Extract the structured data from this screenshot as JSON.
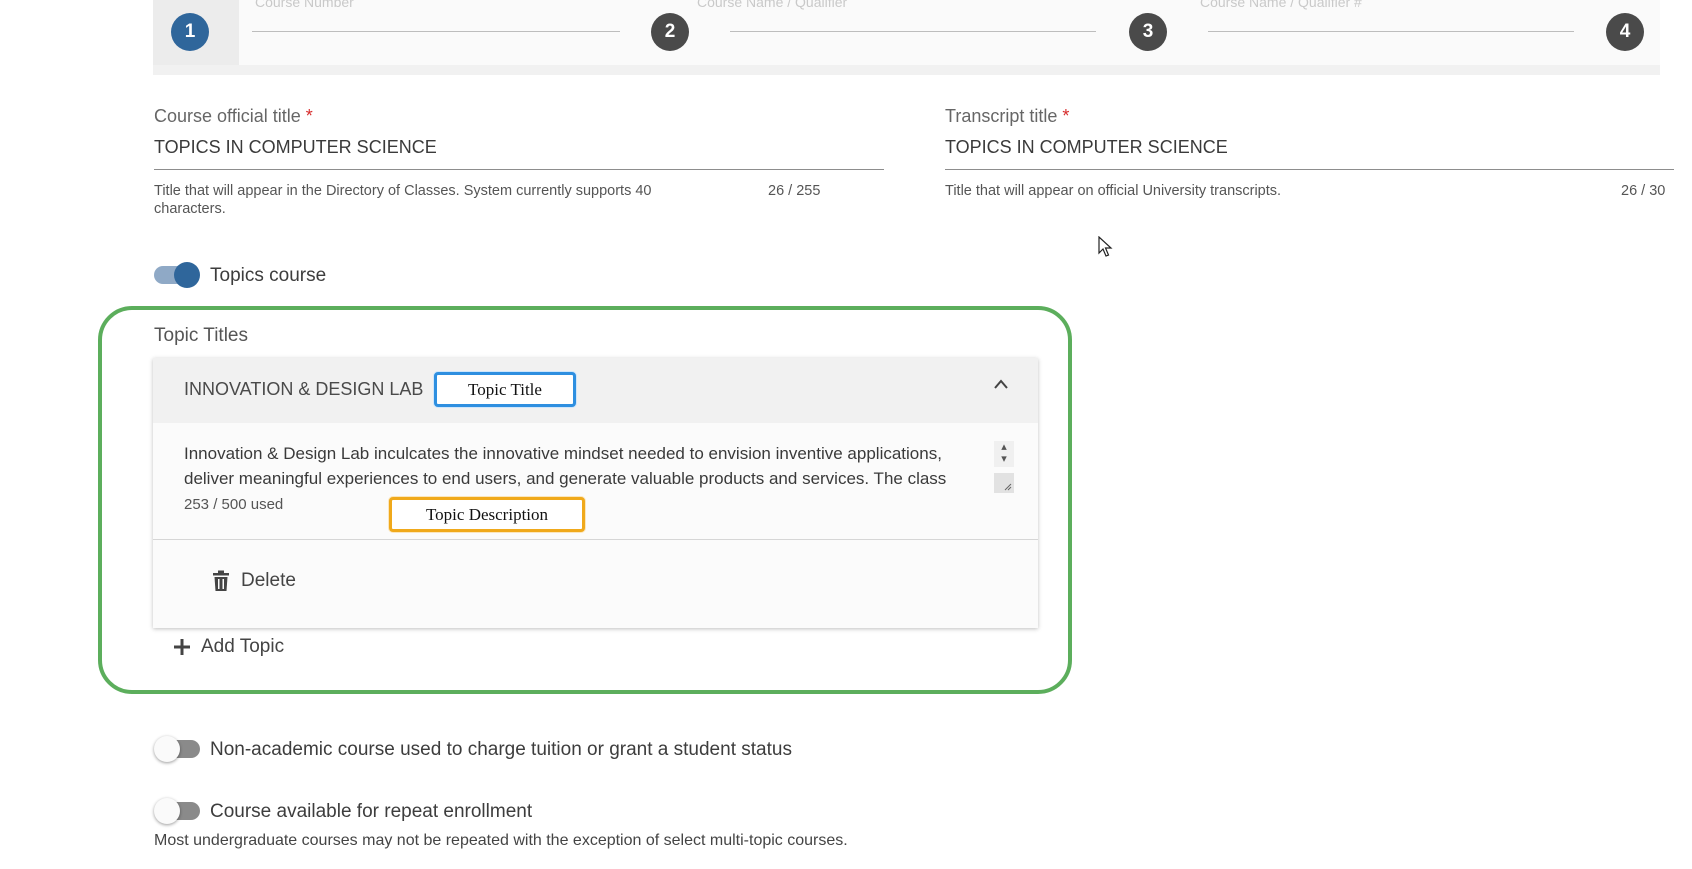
{
  "stepper": {
    "steps": [
      {
        "number": "1",
        "label": "Course Number",
        "active": true
      },
      {
        "number": "2",
        "label": "Course Name / Qualifier",
        "active": false
      },
      {
        "number": "3",
        "label": "Course Name / Qualifier #",
        "active": false
      },
      {
        "number": "4",
        "label": "",
        "active": false
      }
    ]
  },
  "official_title": {
    "label": "Course official title",
    "required_mark": "*",
    "value": "TOPICS IN COMPUTER SCIENCE",
    "helper_line1": "Title that will appear in the Directory of Classes. System currently supports 40",
    "helper_line2": "characters.",
    "counter": "26 / 255"
  },
  "transcript_title": {
    "label": "Transcript title",
    "required_mark": "*",
    "value": "TOPICS IN COMPUTER SCIENCE",
    "helper": "Title that will appear on official University transcripts.",
    "counter": "26 / 30"
  },
  "topics_toggle": {
    "label": "Topics course",
    "on": true,
    "color": "#2f669b"
  },
  "topics": {
    "section_label": "Topic Titles",
    "item": {
      "title": "INNOVATION & DESIGN LAB",
      "description_line1": "Innovation & Design Lab inculcates the innovative mindset needed to envision inventive applications,",
      "description_line2": "deliver meaningful experiences to end users, and generate valuable products and services. The class",
      "used": "253 / 500 used",
      "collapse_icon": "chevron-up-icon"
    },
    "delete_label": "Delete",
    "add_label": "Add Topic"
  },
  "callouts": {
    "title": {
      "text": "Topic Title",
      "color": "#2e8fe0"
    },
    "description": {
      "text": "Topic Description",
      "color": "#f0a91b"
    },
    "frame_color": "#5cae5c"
  },
  "nonacademic_toggle": {
    "label": "Non-academic course used to charge tuition or grant a student status",
    "on": false
  },
  "repeat_toggle": {
    "label": "Course available for repeat enrollment",
    "on": false,
    "helper": "Most undergraduate courses may not be repeated with the exception of select multi-topic courses."
  }
}
